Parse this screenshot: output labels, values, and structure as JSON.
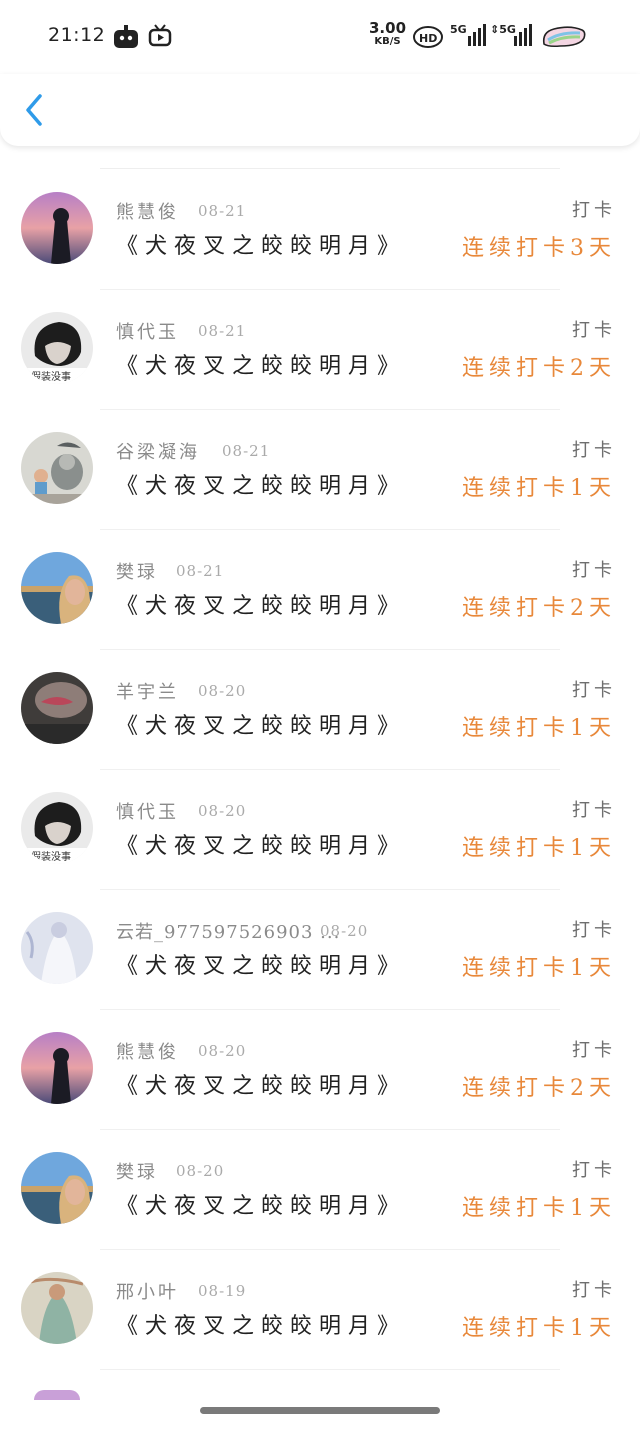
{
  "status_bar": {
    "time": "21:12",
    "speed_value": "3.00",
    "speed_unit": "KB/S",
    "hd_label": "HD",
    "signal1_label": "5G",
    "signal2_label": "5G"
  },
  "header": {
    "back_icon": "chevron-left-icon",
    "accent_color": "#2f9be9"
  },
  "colors": {
    "streak": "#e8883a",
    "name": "#8a8a8a",
    "date": "#aaaaaa",
    "action": "#6e6e6e"
  },
  "items": [
    {
      "name": "熊慧俊",
      "date": "08-21",
      "title": "《犬夜叉之皎皎明月》",
      "action": "打卡",
      "streak": "连续打卡3天",
      "avatar": "dusk-silhouette"
    },
    {
      "name": "慎代玉",
      "date": "08-21",
      "title": "《犬夜叉之皎皎明月》",
      "action": "打卡",
      "streak": "连续打卡2天",
      "avatar": "mono-portrait"
    },
    {
      "name": "谷梁凝海",
      "date": "08-21",
      "title": "《犬夜叉之皎皎明月》",
      "action": "打卡",
      "streak": "连续打卡1天",
      "avatar": "toy-figures"
    },
    {
      "name": "樊琭",
      "date": "08-21",
      "title": "《犬夜叉之皎皎明月》",
      "action": "打卡",
      "streak": "连续打卡2天",
      "avatar": "lake-portrait"
    },
    {
      "name": "羊宇兰",
      "date": "08-20",
      "title": "《犬夜叉之皎皎明月》",
      "action": "打卡",
      "streak": "连续打卡1天",
      "avatar": "dark-closeup"
    },
    {
      "name": "慎代玉",
      "date": "08-20",
      "title": "《犬夜叉之皎皎明月》",
      "action": "打卡",
      "streak": "连续打卡1天",
      "avatar": "mono-portrait"
    },
    {
      "name": "云若_977597526903 ...",
      "date": "08-20",
      "title": "《犬夜叉之皎皎明月》",
      "action": "打卡",
      "streak": "连续打卡1天",
      "avatar": "white-dress"
    },
    {
      "name": "熊慧俊",
      "date": "08-20",
      "title": "《犬夜叉之皎皎明月》",
      "action": "打卡",
      "streak": "连续打卡2天",
      "avatar": "dusk-silhouette"
    },
    {
      "name": "樊琭",
      "date": "08-20",
      "title": "《犬夜叉之皎皎明月》",
      "action": "打卡",
      "streak": "连续打卡1天",
      "avatar": "lake-portrait"
    },
    {
      "name": "邢小叶",
      "date": "08-19",
      "title": "《犬夜叉之皎皎明月》",
      "action": "打卡",
      "streak": "连续打卡1天",
      "avatar": "painted-figure"
    }
  ]
}
